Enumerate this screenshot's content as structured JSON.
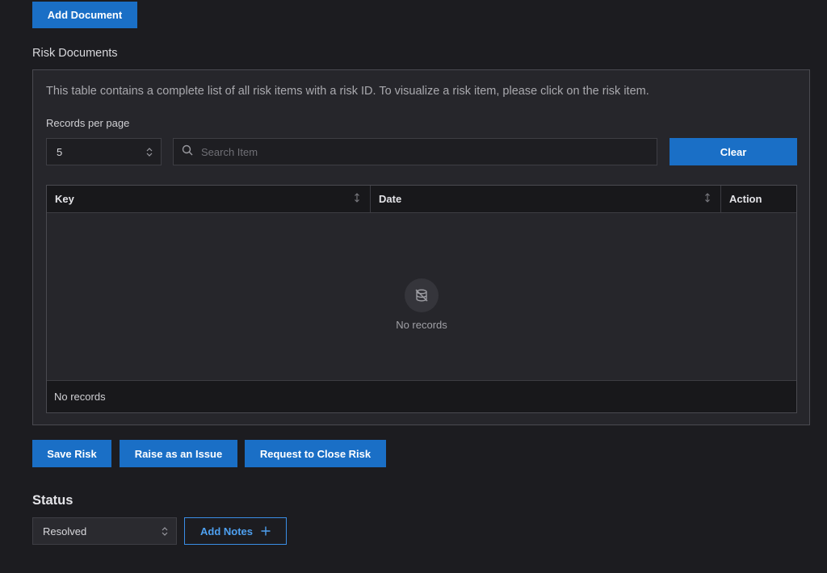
{
  "toolbar": {
    "add_document_label": "Add Document"
  },
  "risk_documents": {
    "section_label": "Risk Documents",
    "description": "This table contains a complete list of all risk items with a risk ID. To visualize a risk item, please click on the risk item.",
    "records_per_page_label": "Records per page",
    "records_per_page_value": "5",
    "search_placeholder": "Search Item",
    "clear_label": "Clear",
    "columns": [
      "Key",
      "Date",
      "Action"
    ],
    "empty_text": "No records",
    "footer_text": "No records"
  },
  "actions": {
    "save_risk_label": "Save Risk",
    "raise_issue_label": "Raise as an Issue",
    "request_close_label": "Request to Close Risk"
  },
  "status": {
    "title": "Status",
    "value": "Resolved",
    "add_notes_label": "Add Notes"
  },
  "colors": {
    "background": "#1c1c20",
    "panel": "#26262b",
    "primary_button": "#1a6fc6",
    "outline_button": "#3a8ee6"
  },
  "icons": {
    "search": "search-icon",
    "sort": "sort-icon",
    "empty": "no-data-icon",
    "select": "chevron-updown-icon",
    "plus": "plus-icon"
  }
}
